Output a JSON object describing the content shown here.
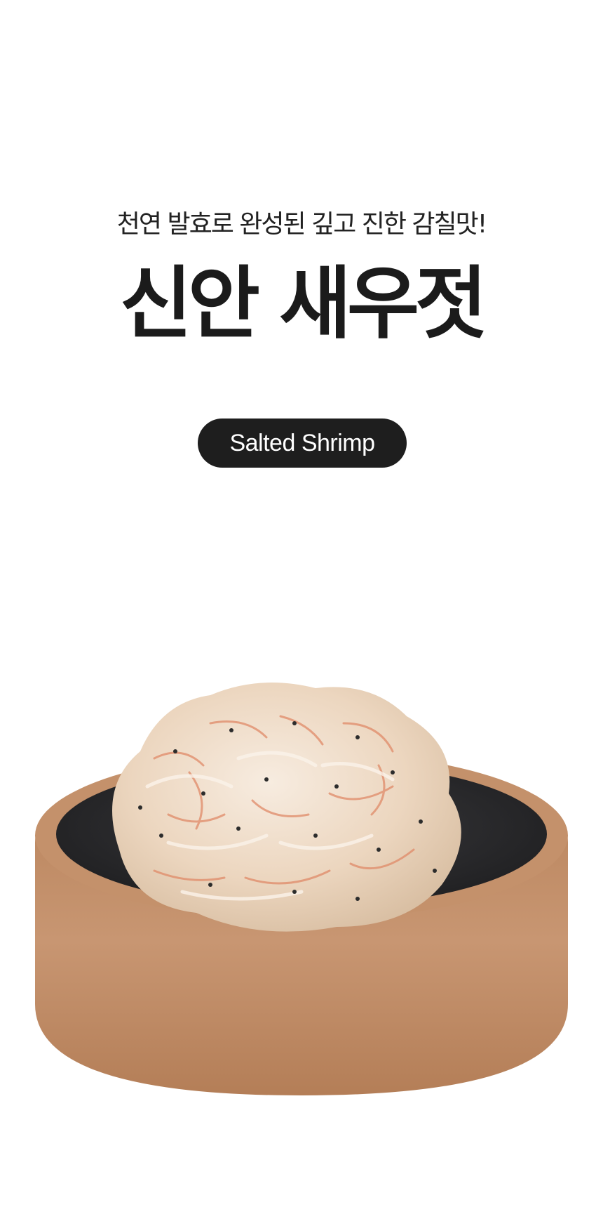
{
  "hero": {
    "tagline": "천연 발효로 완성된 깊고 진한 감칠맛!",
    "headline": "신안 새우젓",
    "badge": "Salted Shrimp"
  },
  "colors": {
    "background": "#ffffff",
    "text": "#1b1b1b",
    "badge_background": "#1e1e1e",
    "badge_text": "#ffffff",
    "bowl_outer": "#c28f68",
    "bowl_inner": "#2b2b2d",
    "shrimp": "#efdcc6",
    "shrimp_accent": "#e88a6a"
  },
  "product_image": {
    "icon": "salted-shrimp-bowl-illustration"
  }
}
